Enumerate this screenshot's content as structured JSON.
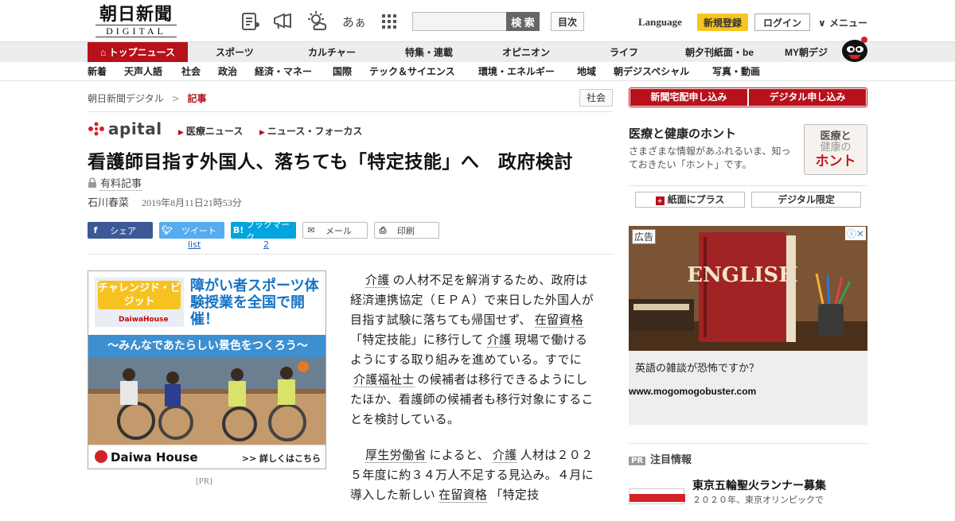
{
  "header": {
    "logo_jp": "朝日新聞",
    "logo_en": "DIGITAL",
    "search_button": "検 索",
    "search_value": "",
    "index_button": "目次",
    "language": "Language",
    "signup": "新規登録",
    "login": "ログイン",
    "menu": "メニュー",
    "font_icon_text": "あぁ"
  },
  "nav_primary": [
    "トップニュース",
    "スポーツ",
    "カルチャー",
    "特集・連載",
    "オピニオン",
    "ライフ",
    "朝夕刊紙面・be",
    "MY朝デジ"
  ],
  "nav_secondary": [
    "新着",
    "天声人語",
    "社会",
    "政治",
    "経済・マネー",
    "国際",
    "テック＆サイエンス",
    "環境・エネルギー",
    "地域",
    "朝デジスペシャル",
    "写真・動画"
  ],
  "breadcrumb": {
    "root": "朝日新聞デジタル",
    "sep": ">",
    "current": "記事"
  },
  "category_tag": "社会",
  "apital": {
    "name": "apital",
    "links": [
      "医療ニュース",
      "ニュース・フォーカス"
    ]
  },
  "article": {
    "headline": "看護師目指す外国人、落ちても「特定技能」へ　政府検討",
    "paid_label": "有料記事",
    "author": "石川春菜",
    "date": "2019年8月11日21時53分"
  },
  "share": {
    "facebook": "シェア",
    "twitter": "ツイート",
    "hatena": "ブックマーク",
    "mail": "メール",
    "print": "印刷",
    "twitter_count": "list",
    "hatena_count": "2"
  },
  "ad_left": {
    "badge": "チャレンジド・ビジット",
    "badge_en": "DaiwaHouse",
    "headline": "障がい者スポーツ体験授業を全国で開催！",
    "band": "〜みんなであたらしい景色をつくろう〜",
    "brand": "Daiwa House",
    "more": ">> 詳しくはこちら",
    "pr": "[PR]"
  },
  "body": {
    "p1": [
      {
        "t": "介護",
        "kw": true
      },
      {
        "t": "の人材不足を解消するため、政府は経済連携協定（ＥＰＡ）で来日した外国人が目指す試験に落ちても帰国せず、",
        "kw": false
      },
      {
        "t": "在留資格",
        "kw": true
      },
      {
        "t": "「特定技能」に移行して",
        "kw": false
      },
      {
        "t": "介護",
        "kw": true
      },
      {
        "t": "現場で働けるようにする取り組みを進めている。すでに",
        "kw": false
      },
      {
        "t": "介護福祉士",
        "kw": true
      },
      {
        "t": "の候補者は移行できるようにしたほか、看護師の候補者も移行対象にすることを検討している。",
        "kw": false
      }
    ],
    "p2": [
      {
        "t": "厚生労働省",
        "kw": true
      },
      {
        "t": "によると、",
        "kw": false
      },
      {
        "t": "介護",
        "kw": true
      },
      {
        "t": "人材は２０２５年度に約３４万人不足する見込み。４月に導入した新しい",
        "kw": false
      },
      {
        "t": "在留資格",
        "kw": true
      },
      {
        "t": "「特定技",
        "kw": false
      }
    ]
  },
  "sidebar": {
    "sub_home": "新聞宅配申し込み",
    "sub_digital": "デジタル申し込み",
    "honto_title": "医療と健康のホント",
    "honto_desc": "さまざまな情報があふれるいま、知っておきたい「ホント」です。",
    "honto_logo": [
      "医療と",
      "健康の",
      "ホント"
    ],
    "plus_paper": "紙面にプラス",
    "digital_only": "デジタル限定",
    "ad_label": "広告",
    "ad_question": "英語の雑談が恐怖ですか？",
    "ad_url": "www.mogomogobuster.com",
    "book_text": "ENGLISH",
    "pr_heading": "注目情報",
    "pr_tag": "PR",
    "pr_title": "東京五輪聖火ランナー募集",
    "pr_sub": "２０２０年、東京オリンピックで"
  }
}
